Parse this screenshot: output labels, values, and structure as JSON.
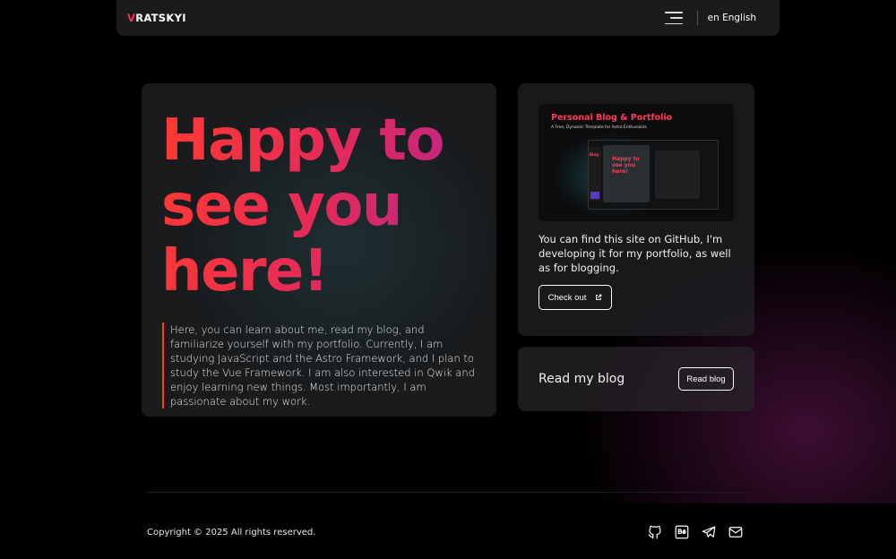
{
  "header": {
    "logo_first": "V",
    "logo_rest": "RATSKYI",
    "language": "en English"
  },
  "hero": {
    "title": "Happy to see you here!",
    "description": "Here, you can learn about me, read my blog, and familiarize yourself with my portfolio. Currently, I am studying JavaScript and the Astro Framework, and I plan to study the Vue Framework. I am also interested in Qwik and enjoy learning new things. Most importantly, I am passionate about my work."
  },
  "github_card": {
    "preview": {
      "title": "Personal Blog & Portfolio",
      "subtitle": "A Free, Dynamic Template for Astro Enthusiasts",
      "inner_title": "Happy to see you here!",
      "side_label": "Blog"
    },
    "text": "You can find this site on GitHub, I'm developing it for my portfolio, as well as for blogging.",
    "button_label": "Check out"
  },
  "blog_card": {
    "label": "Read my blog",
    "button_label": "Read blog"
  },
  "footer": {
    "copyright": "Copyright © 2025 All rights reserved.",
    "socials": [
      "github-icon",
      "behance-icon",
      "telegram-icon",
      "mail-icon"
    ]
  },
  "colors": {
    "accent_red": "#ff3a32",
    "accent_pink": "#e52a5a",
    "accent_purple": "#b02592",
    "background": "#000000"
  }
}
